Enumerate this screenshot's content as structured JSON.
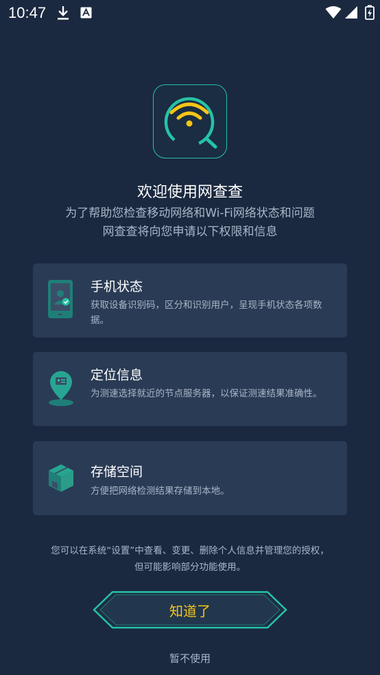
{
  "status_bar": {
    "time": "10:47",
    "icons": [
      "download-icon",
      "a-badge-icon",
      "wifi-icon",
      "signal-icon",
      "battery-icon"
    ]
  },
  "header": {
    "logo_icon": "wifi-search-icon",
    "title": "欢迎使用网查查",
    "subtitle_line1": "为了帮助您检查移动网络和Wi-Fi网络状态和问题",
    "subtitle_line2": "网查查将向您申请以下权限和信息"
  },
  "permissions": [
    {
      "icon": "phone-status-icon",
      "title": "手机状态",
      "desc": "获取设备识别码，区分和识别用户，呈现手机状态各项数据。"
    },
    {
      "icon": "location-icon",
      "title": "定位信息",
      "desc": "为测速选择就近的节点服务器，以保证测速结果准确性。"
    },
    {
      "icon": "storage-box-icon",
      "title": "存储空间",
      "desc": "方便把网络检测结果存储到本地。"
    }
  ],
  "notice_line1": "您可以在系统“设置”中查看、变更、删除个人信息并管理您的授权，",
  "notice_line2": "但可能影响部分功能使用。",
  "ok_button_label": "知道了",
  "skip_label": "暂不使用",
  "colors": {
    "background": "#1b2940",
    "card": "#2a3b55",
    "accent_teal": "#26c2a6",
    "accent_yellow": "#f5c518"
  }
}
